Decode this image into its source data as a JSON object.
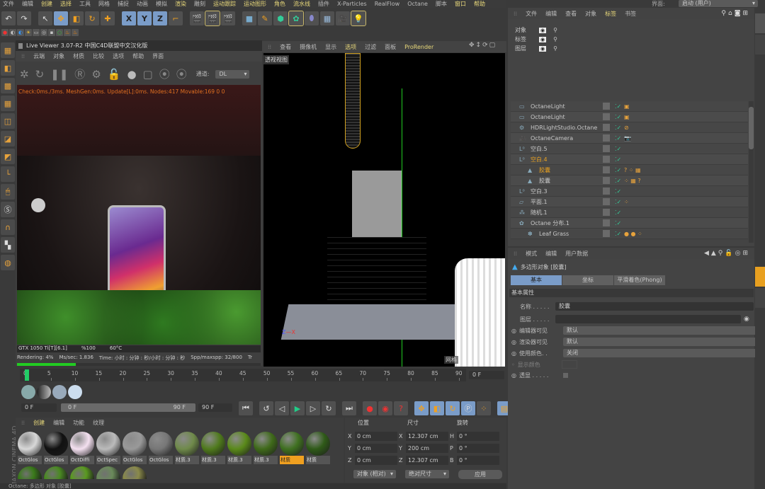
{
  "menu": [
    "文件",
    "编辑",
    "创建",
    "选择",
    "工具",
    "网格",
    "捕捉",
    "动画",
    "模拟",
    "渲染",
    "雕刻",
    "运动跟踪",
    "运动图形",
    "角色",
    "流水线",
    "插件",
    "X-Particles",
    "RealFlow",
    "Octane",
    "脚本",
    "窗口",
    "帮助"
  ],
  "menu_highlight": [
    2,
    3,
    9,
    11,
    12,
    13,
    14,
    20,
    21
  ],
  "layout": {
    "label": "界面:",
    "value": "启动 (用户)"
  },
  "toolbar": {
    "undo": "↶",
    "redo": "↷",
    "axis_x": "X",
    "axis_y": "Y",
    "axis_z": "Z"
  },
  "live_viewer": {
    "title": "Live Viewer 3.07-R2 中国C4D联盟中文汉化版",
    "menu": [
      "云端",
      "对象",
      "材质",
      "比较",
      "选项",
      "帮助",
      "界面"
    ],
    "channel_label": "通道:",
    "channel_value": "DL",
    "stats": "Check:0ms./3ms. MeshGen:0ms. Update[L]:0ms. Nodes:417 Movable:169  0 0",
    "gpu": "GTX 1050 Ti[T][6.1]",
    "gpu_pct": "%100",
    "gpu_temp": "60°C",
    "rendering": "Rendering: 4%",
    "ms_sec": "Ms/sec: 1.836",
    "time": "Time: 小时 : 分钟 : 秒/小时 : 分钟 : 秒",
    "spp": "Spp/maxspp: 32/800",
    "tr": "Tr",
    "progress": 0.04
  },
  "viewport": {
    "menu": [
      "查看",
      "摄像机",
      "显示",
      "选项",
      "过滤",
      "面板",
      "ProRender"
    ],
    "menu_highlight": [
      3,
      6
    ],
    "label": "透视视图",
    "grid_label": "网格"
  },
  "timeline": {
    "ticks": [
      "0",
      "5",
      "10",
      "15",
      "20",
      "25",
      "30",
      "35",
      "40",
      "45",
      "50",
      "55",
      "60",
      "65",
      "70",
      "75",
      "80",
      "85",
      "90"
    ],
    "current_frame": "0 F"
  },
  "playback": {
    "start": "0 F",
    "range_start": "0 F",
    "range_end": "90 F",
    "end": "90 F"
  },
  "materials": {
    "menu": [
      "创建",
      "编辑",
      "功能",
      "纹理"
    ],
    "items": [
      {
        "label": "OctGlos",
        "color": "#d8d8d8"
      },
      {
        "label": "OctGlos",
        "color": "#111111"
      },
      {
        "label": "OctDiffi",
        "color": "#f4e0f0"
      },
      {
        "label": "OctSpec",
        "color": "#bbbbbb"
      },
      {
        "label": "OctGlos",
        "color": "#999999"
      },
      {
        "label": "OctGlos",
        "color": "#777777"
      },
      {
        "label": "材质.3",
        "color": "#6f8a4a"
      },
      {
        "label": "材质.3",
        "color": "#4f7a1c"
      },
      {
        "label": "材质.3",
        "color": "#5a8a1a"
      },
      {
        "label": "材质.3",
        "color": "#3f6a1a"
      },
      {
        "label": "材质",
        "color": "#3f7020",
        "selected": true
      },
      {
        "label": "材质",
        "color": "#2f5a18"
      }
    ],
    "row2_colors": [
      "#3a7a1a",
      "#4a8a22",
      "#5a9a20",
      "#6a8a5a",
      "#8a8a4a"
    ]
  },
  "coords": {
    "headers": [
      "位置",
      "尺寸",
      "旋转"
    ],
    "rows": [
      {
        "a": "X",
        "pos": "0 cm",
        "b": "X",
        "size": "12.307 cm",
        "c": "H",
        "rot": "0 °"
      },
      {
        "a": "Y",
        "pos": "0 cm",
        "b": "Y",
        "size": "200 cm",
        "c": "P",
        "rot": "0 °"
      },
      {
        "a": "Z",
        "pos": "0 cm",
        "b": "Z",
        "size": "12.307 cm",
        "c": "B",
        "rot": "0 °"
      }
    ],
    "mode": "对象 (相对)",
    "size_mode": "绝对尺寸",
    "apply": "应用"
  },
  "status_bar": "Octane:     多边形 对象 [胶囊]",
  "brand": "MAXON CINEMA 4D",
  "object_manager": {
    "menu": [
      "文件",
      "编辑",
      "查看",
      "对象",
      "标签",
      "书签"
    ],
    "menu_highlight": 4,
    "layers": [
      "对象",
      "标签",
      "图层"
    ],
    "objects": [
      {
        "name": "OctaneLight",
        "icon": "▭",
        "tags": "▣"
      },
      {
        "name": "OctaneLight",
        "icon": "▭",
        "tags": "▣"
      },
      {
        "name": "HDRLightStudio.Octane",
        "icon": "⚙",
        "tags": "⊘"
      },
      {
        "name": "OctaneCamera",
        "icon": "🎥",
        "tags": "📷"
      },
      {
        "name": "空白.5",
        "icon": "L⁰",
        "tags": ""
      },
      {
        "name": "空白.4",
        "icon": "L⁰",
        "tags": "",
        "active": true
      },
      {
        "name": "胶囊",
        "icon": "▲",
        "tags": "? ⁘ ▦",
        "active": true,
        "indent": 1
      },
      {
        "name": "胶囊",
        "icon": "▲",
        "tags": "⁘ ▦ ?",
        "indent": 1
      },
      {
        "name": "空白.3",
        "icon": "L⁰",
        "tags": ""
      },
      {
        "name": "平面.1",
        "icon": "▱",
        "tags": "⁘"
      },
      {
        "name": "随机.1",
        "icon": "⁂",
        "tags": ""
      },
      {
        "name": "Octane 分布.1",
        "icon": "✿",
        "tags": ""
      },
      {
        "name": "Leaf Grass",
        "icon": "✽",
        "tags": "● ● ⁘",
        "indent": 1
      }
    ]
  },
  "attributes": {
    "menu": [
      "模式",
      "编辑",
      "用户数据"
    ],
    "title": "多边形对象 [胶囊]",
    "tabs": [
      "基本",
      "坐标",
      "平滑着色(Phong)"
    ],
    "section": "基本属性",
    "name_label": "名称 . . . . .",
    "name_value": "胶囊",
    "layer_label": "图层 . . . . .",
    "editor_vis_label": "编辑器可见",
    "editor_vis": "默认",
    "render_vis_label": "渲染器可见",
    "render_vis": "默认",
    "use_color_label": "使用颜色. .",
    "use_color": "关闭",
    "display_color_label": "显示颜色",
    "xray_label": "透显 . . . . ."
  },
  "colors": {
    "accent": "#e8a020",
    "selected_tab": "#7a9cc8",
    "menu_highlight": "#e8d87a"
  }
}
